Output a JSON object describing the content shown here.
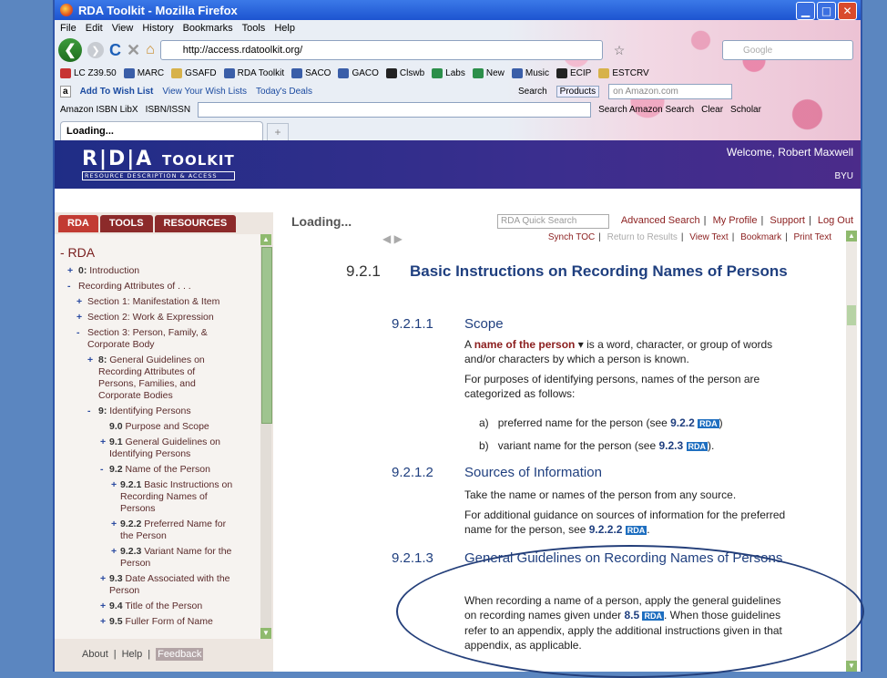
{
  "window": {
    "title": "RDA Toolkit - Mozilla Firefox"
  },
  "menu": [
    "File",
    "Edit",
    "View",
    "History",
    "Bookmarks",
    "Tools",
    "Help"
  ],
  "address": {
    "url": "http://access.rdatoolkit.org/"
  },
  "search_engine_placeholder": "Google",
  "bookmarks": [
    "LC Z39.50",
    "MARC",
    "GSAFD",
    "RDA Toolkit",
    "SACO",
    "GACO",
    "Clswb",
    "Labs",
    "New",
    "Music",
    "ECIP",
    "ESTCRV"
  ],
  "amazon_bar": {
    "add": "Add To Wish List",
    "view": "View Your Wish Lists",
    "deals": "Today's Deals",
    "search_label": "Search",
    "products": "Products",
    "search_value": "on Amazon.com"
  },
  "isbn_bar": {
    "libx": "Amazon ISBN LibX",
    "isbn": "ISBN/ISSN",
    "amz_search": "Search Amazon Search",
    "clear": "Clear",
    "scholar": "Scholar"
  },
  "tab": {
    "title": "Loading..."
  },
  "banner": {
    "logo_main": "R|D|A",
    "logo_tail": "TOOLKIT",
    "logo_sub": "RESOURCE DESCRIPTION & ACCESS",
    "welcome": "Welcome, Robert Maxwell",
    "org": "BYU"
  },
  "sidebar": {
    "tabs": [
      "RDA",
      "TOOLS",
      "RESOURCES"
    ],
    "root": "- RDA",
    "items": [
      {
        "pm": "+",
        "num": "0:",
        "label": "Introduction"
      },
      {
        "pm": "-",
        "num": "",
        "label": "Recording Attributes of . . ."
      },
      {
        "pm": "+",
        "num": "",
        "label": "Section 1: Manifestation & Item"
      },
      {
        "pm": "+",
        "num": "",
        "label": "Section 2: Work & Expression"
      },
      {
        "pm": "-",
        "num": "",
        "label": "Section 3: Person, Family, & Corporate Body"
      },
      {
        "pm": "+",
        "num": "8:",
        "label": "General Guidelines on Recording Attributes of Persons, Families, and Corporate Bodies"
      },
      {
        "pm": "-",
        "num": "9:",
        "label": "Identifying Persons"
      },
      {
        "pm": "",
        "num": "9.0",
        "label": "Purpose and Scope"
      },
      {
        "pm": "+",
        "num": "9.1",
        "label": "General Guidelines on Identifying Persons"
      },
      {
        "pm": "-",
        "num": "9.2",
        "label": "Name of the Person"
      },
      {
        "pm": "+",
        "num": "9.2.1",
        "label": "Basic Instructions on Recording Names of Persons"
      },
      {
        "pm": "+",
        "num": "9.2.2",
        "label": "Preferred Name for the Person"
      },
      {
        "pm": "+",
        "num": "9.2.3",
        "label": "Variant Name for the Person"
      },
      {
        "pm": "+",
        "num": "9.3",
        "label": "Date Associated with the Person"
      },
      {
        "pm": "+",
        "num": "9.4",
        "label": "Title of the Person"
      },
      {
        "pm": "+",
        "num": "9.5",
        "label": "Fuller Form of Name"
      }
    ],
    "footer": {
      "about": "About",
      "help": "Help",
      "feedback": "Feedback"
    }
  },
  "content": {
    "loading": "Loading...",
    "quick_search": "RDA Quick Search",
    "top_links": [
      "Advanced Search",
      "My Profile",
      "Support",
      "Log Out"
    ],
    "sub_links": {
      "synch": "Synch TOC",
      "return": "Return to Results",
      "view_text": "View Text",
      "bookmark": "Bookmark",
      "print": "Print Text"
    },
    "s1": {
      "num": "9.2.1",
      "title": "Basic Instructions on Recording Names of Persons"
    },
    "s2": {
      "num": "9.2.1.1",
      "title": "Scope",
      "p1_a": "A ",
      "p1_term": "name of the person",
      "p1_b": " ▾ is a word, character, or group of words and/or characters by which a person is known.",
      "p2": "For purposes of identifying persons, names of the person are categorized as follows:",
      "list": [
        {
          "marker": "a)",
          "text": "preferred name for the person (see ",
          "ref": "9.2.2",
          "tail": ")"
        },
        {
          "marker": "b)",
          "text": "variant name for the person (see ",
          "ref": "9.2.3",
          "tail": ")."
        }
      ]
    },
    "s3": {
      "num": "9.2.1.2",
      "title": "Sources of Information",
      "p1": "Take the name or names of the person from any source.",
      "p2": "For additional guidance on sources of information for the preferred name for the person, see ",
      "ref": "9.2.2.2",
      "tail": "."
    },
    "s4": {
      "num": "9.2.1.3",
      "title": "General Guidelines on Recording Names of Persons",
      "p_a": "When recording a name of a person, apply the general guidelines on recording names given under ",
      "ref": "8.5",
      "p_b": ". When those guidelines refer to an appendix, apply the additional instructions given in that appendix, as applicable."
    },
    "rda_tag": "RDA"
  }
}
